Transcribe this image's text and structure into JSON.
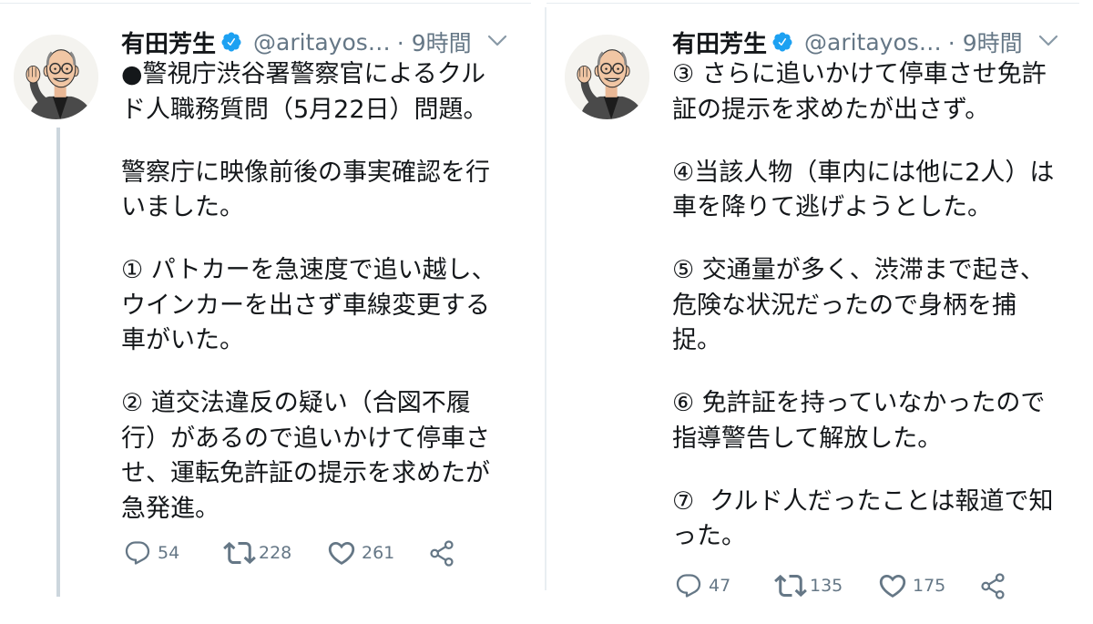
{
  "tweets": [
    {
      "author": {
        "name": "有田芳生",
        "handle": "@aritayos…",
        "time": "· 9時間"
      },
      "paragraphs": [
        [
          "●警視庁渋谷署警察官によるクル",
          "ド人職務質問（5月22日）問題。"
        ],
        [
          "警察庁に映像前後の事実確認を行",
          "いました。"
        ],
        [
          "① パトカーを急速度で追い越し、",
          "ウインカーを出さず車線変更する",
          "車がいた。"
        ],
        [
          "② 道交法違反の疑い（合図不履",
          "行）があるので追いかけて停車さ",
          "せ、運転免許証の提示を求めたが",
          "急発進。"
        ]
      ],
      "stats": {
        "replies": "54",
        "retweets": "228",
        "likes": "261"
      }
    },
    {
      "author": {
        "name": "有田芳生",
        "handle": "@aritayos…",
        "time": "· 9時間"
      },
      "paragraphs": [
        [
          "③ さらに追いかけて停車させ免許",
          "証の提示を求めたが出さず。"
        ],
        [
          "④当該人物（車内には他に2人）は",
          "車を降りて逃げようとした。"
        ],
        [
          "⑤ 交通量が多く、渋滞まで起き、",
          "危険な状況だったので身柄を捕",
          "捉。"
        ],
        [
          "⑥ 免許証を持っていなかったので",
          "指導警告して解放した。"
        ],
        [
          "⑦  クルド人だったことは報道で知",
          "った。"
        ]
      ],
      "stats": {
        "replies": "47",
        "retweets": "135",
        "likes": "175"
      }
    }
  ],
  "icons": {
    "verified": "verified-badge-icon",
    "menu": "chevron-down-icon",
    "reply": "reply-icon",
    "retweet": "retweet-icon",
    "like": "heart-icon",
    "share": "share-icon"
  },
  "colors": {
    "text": "#14171a",
    "secondary": "#657786",
    "verified": "#1da1f2",
    "thread_line": "#ccd6dd"
  }
}
